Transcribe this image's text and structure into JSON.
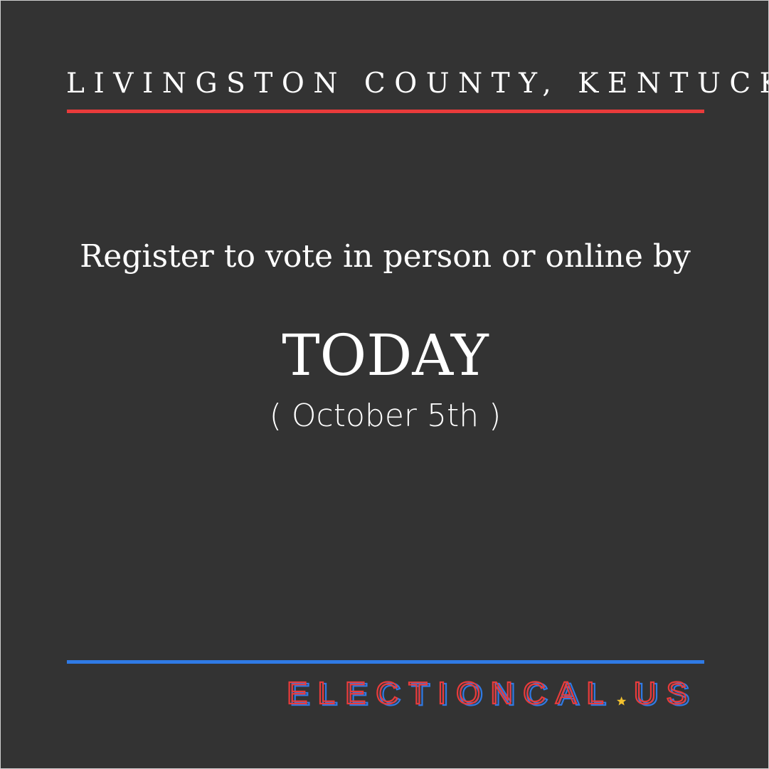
{
  "header": {
    "location": "LIVINGSTON COUNTY, KENTUCKY"
  },
  "message": {
    "register_text": "Register to vote in person or online by",
    "deadline_label": "TODAY",
    "deadline_date": "( October 5th )"
  },
  "brand": {
    "wordmark": "ELECTIONCAL.US",
    "name_part": "ELECTIONCAL",
    "tld_part": "US"
  },
  "colors": {
    "background": "#333333",
    "accent_red": "#e93b3b",
    "accent_blue": "#2f7ae5",
    "star_yellow": "#f2c12e",
    "text": "#ffffff"
  }
}
